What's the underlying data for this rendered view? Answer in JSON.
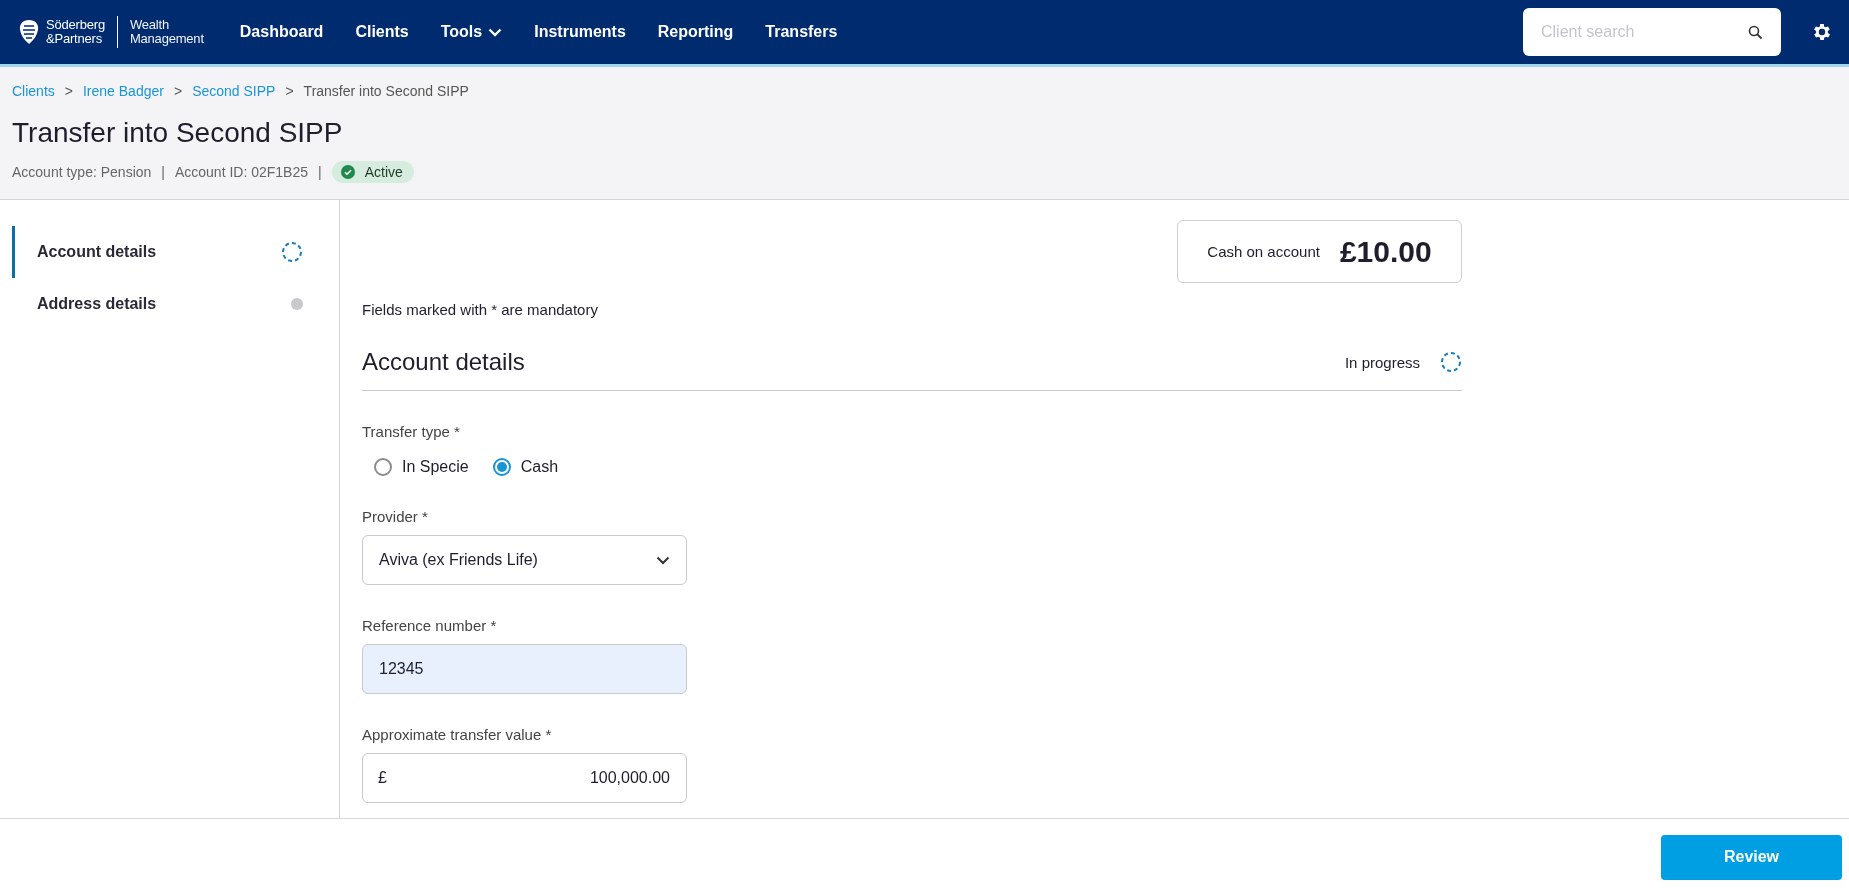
{
  "header": {
    "logo": {
      "brand_lines": [
        "Söderberg",
        "&Partners"
      ],
      "product_lines": [
        "Wealth",
        "Management"
      ]
    },
    "nav": [
      {
        "label": "Dashboard",
        "dropdown": false
      },
      {
        "label": "Clients",
        "dropdown": false
      },
      {
        "label": "Tools",
        "dropdown": true
      },
      {
        "label": "Instruments",
        "dropdown": false
      },
      {
        "label": "Reporting",
        "dropdown": false
      },
      {
        "label": "Transfers",
        "dropdown": false
      }
    ],
    "search": {
      "placeholder": "Client search"
    }
  },
  "breadcrumb": [
    {
      "kind": "link",
      "text": "Clients"
    },
    {
      "kind": "separator",
      "text": ">"
    },
    {
      "kind": "link",
      "text": "Irene Badger"
    },
    {
      "kind": "separator",
      "text": ">"
    },
    {
      "kind": "link",
      "text": "Second SIPP"
    },
    {
      "kind": "separator",
      "text": ">"
    },
    {
      "kind": "current",
      "text": "Transfer into Second SIPP"
    }
  ],
  "title": "Transfer into Second SIPP",
  "meta": [
    {
      "kind": "text",
      "text": "Account type: Pension"
    },
    {
      "kind": "separator",
      "text": "|"
    },
    {
      "kind": "text",
      "text": "Account ID: 02F1B25"
    },
    {
      "kind": "separator",
      "text": "|"
    },
    {
      "kind": "badge",
      "text": "Active"
    }
  ],
  "steps": [
    {
      "label": "Account details",
      "selected": true,
      "in_progress": true
    },
    {
      "label": "Address details",
      "selected": false,
      "in_progress": false
    }
  ],
  "cash": {
    "label": "Cash on account",
    "amount": "£10.00"
  },
  "mandatory_note": "Fields marked with * are mandatory",
  "section": {
    "title": "Account details",
    "status_text": "In progress",
    "in_progress": true
  },
  "fields": [
    {
      "kind": "radio",
      "label": "Transfer type *",
      "options": [
        {
          "label": "In Specie",
          "selected": false
        },
        {
          "label": "Cash",
          "selected": true
        }
      ]
    },
    {
      "kind": "select",
      "label": "Provider *",
      "value": "Aviva (ex Friends Life)"
    },
    {
      "kind": "text",
      "label": "Reference number *",
      "value": "12345",
      "autofilled": true
    },
    {
      "kind": "currency",
      "label": "Approximate transfer value *",
      "prefix": "£",
      "value": "100,000.00"
    }
  ],
  "footer": {
    "button": "Review"
  }
}
